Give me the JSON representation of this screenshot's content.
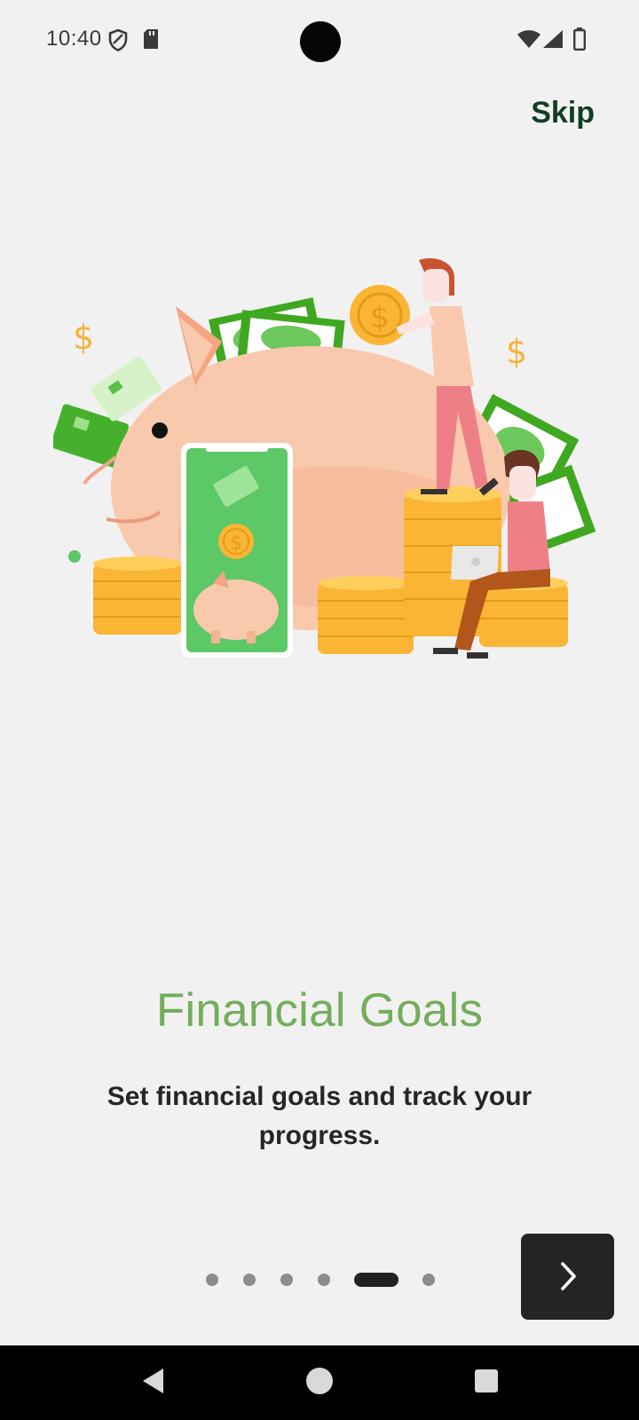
{
  "status_bar": {
    "time": "10:40",
    "icons": [
      "shield-icon",
      "sd-card-icon",
      "wifi-icon",
      "signal-icon",
      "battery-icon"
    ]
  },
  "header": {
    "skip_label": "Skip"
  },
  "onboarding": {
    "title": "Financial Goals",
    "subtitle": "Set financial goals and track your progress.",
    "page_count": 6,
    "current_page": 5,
    "illustration": "piggy-bank-savings-illustration"
  },
  "footer": {
    "next_icon": "chevron-right-icon"
  },
  "navigation_bar": {
    "buttons": [
      "back-icon",
      "home-icon",
      "recents-icon"
    ]
  },
  "colors": {
    "background": "#f2f1f2",
    "title_green": "#74ad5b",
    "skip_text": "#123d23",
    "next_button": "#242424",
    "dot_inactive": "#8c8c8c",
    "dot_active": "#222222"
  }
}
